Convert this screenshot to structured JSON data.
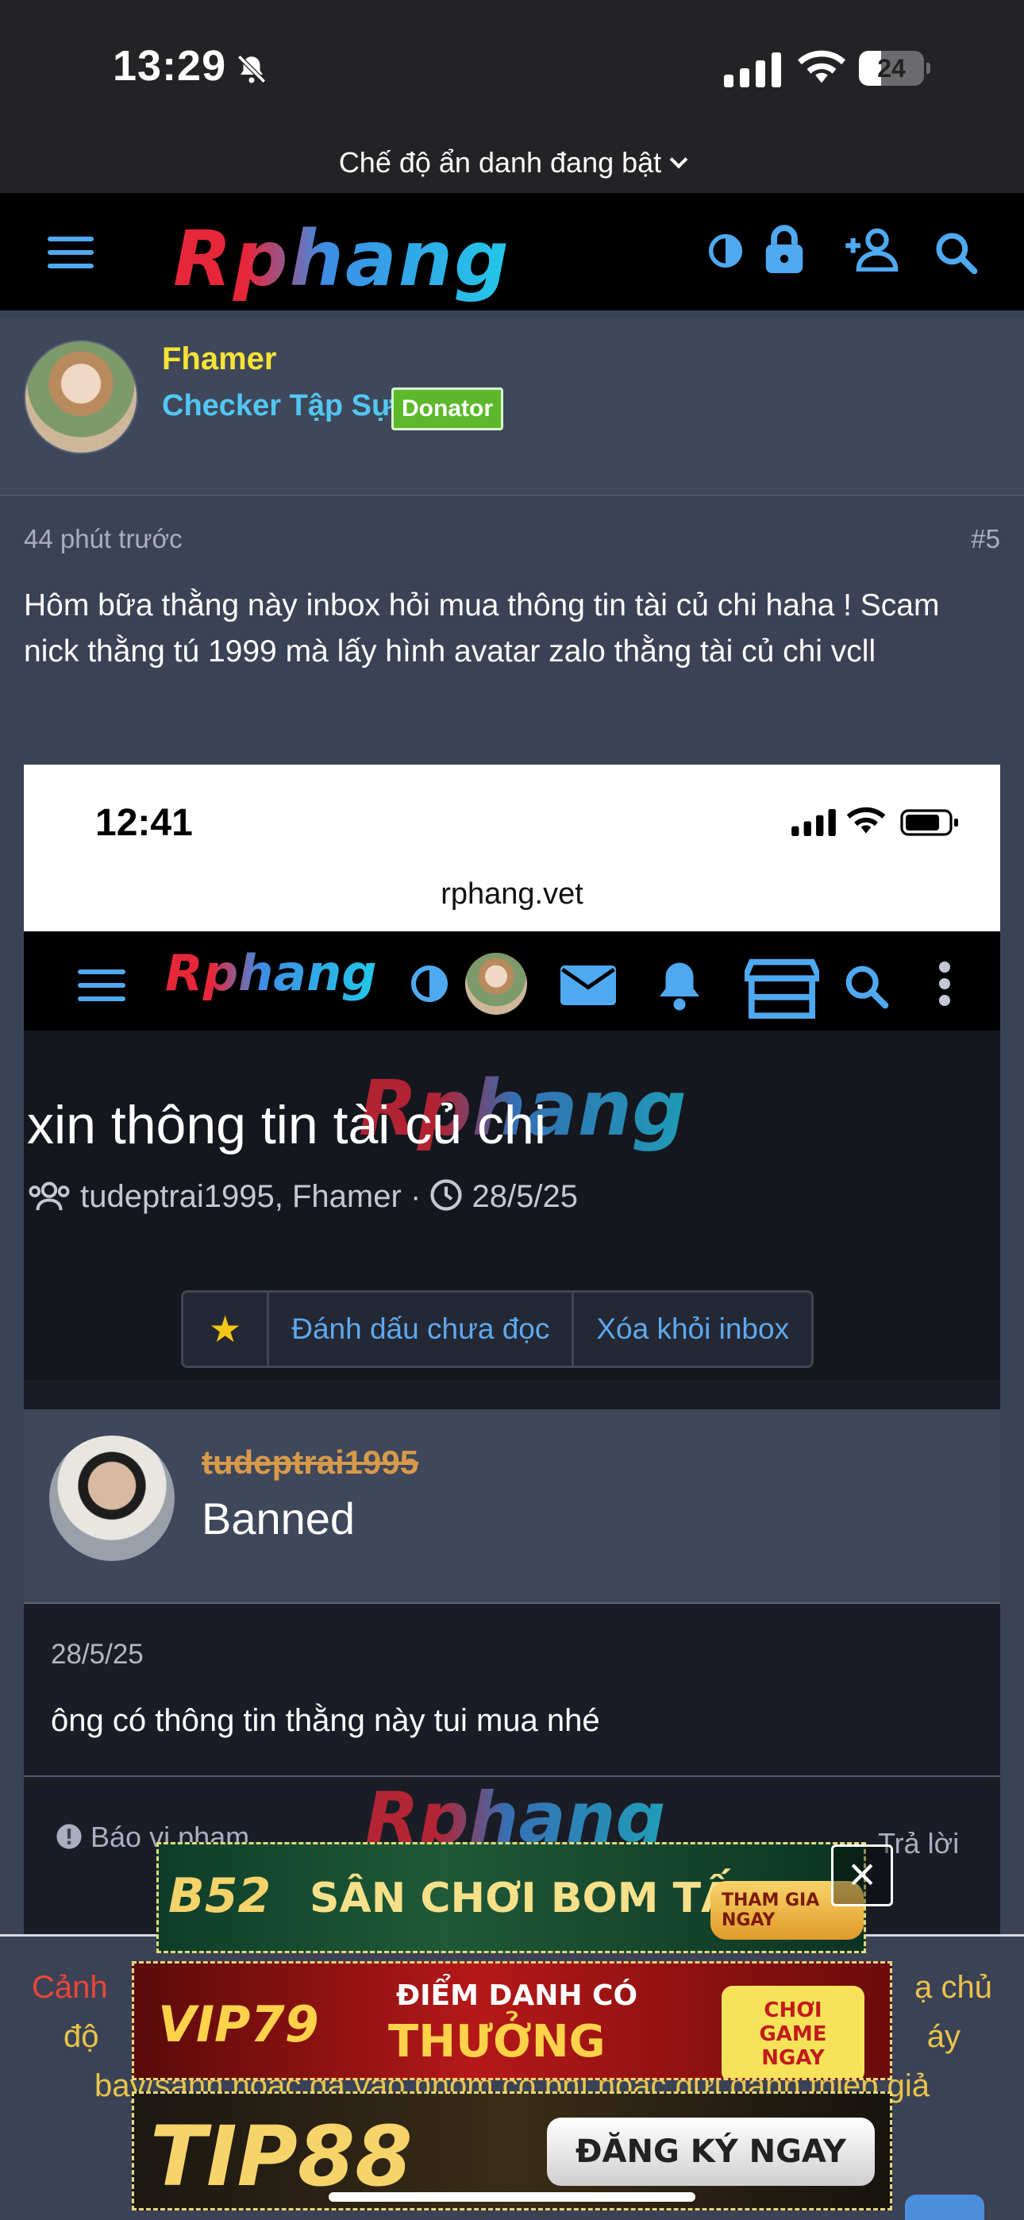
{
  "status_bar": {
    "time": "13:29",
    "battery": "24"
  },
  "browser": {
    "incognito_label": "Chế độ ẩn danh đang bật"
  },
  "nav": {
    "logo": "Rphang"
  },
  "member": {
    "name": "Fhamer",
    "title": "Checker Tập Sự",
    "badge": "Donator"
  },
  "post": {
    "time": "44 phút trước",
    "number": "#5",
    "body": "Hôm bữa thằng này inbox hỏi mua thông tin tài củ chi haha ! Scam nick thằng tú 1999 mà lấy hình avatar zalo thằng tài củ chi vcll"
  },
  "screenshot": {
    "time": "12:41",
    "url": "rphang.vet",
    "logo": "Rphang",
    "watermark": "Rphang",
    "thread_title": "xin thông tin tài củ chi",
    "participants": "tudeptrai1995, Fhamer",
    "date": "28/5/25",
    "buttons": {
      "star": "★",
      "mark_unread": "Đánh dấu chưa đọc",
      "remove_inbox": "Xóa khỏi inbox"
    },
    "sender_name": "tudeptrai1995",
    "sender_status": "Banned",
    "message_date": "28/5/25",
    "message": "ông có thông tin thằng này tui mua nhé",
    "report": "Báo vi phạm",
    "reply": "Trả lời"
  },
  "warning": {
    "prefix": "Cảnh",
    "line1_end": "ạ chủ",
    "line2_start": "độ",
    "line2_end": "áy",
    "line3": "bay/sảnh hoặc gạ vào nhóm có phí hoặc gửi danh thiếp giả"
  },
  "ads": {
    "b52_brand": "B52",
    "b52_text": "SÂN CHƠI BOM TẤN",
    "b52_cta": "THAM GIA NGAY",
    "vip79_brand": "VIP79",
    "vip79_text1": "ĐIỂM DANH CÓ",
    "vip79_text2": "THƯỞNG",
    "vip79_cta": "CHƠI GAME NGAY",
    "tip88_brand": "TIP88",
    "tip88_cta": "ĐĂNG KÝ NGAY",
    "close": "×"
  },
  "colors": {
    "accent": "#4fa9f0",
    "username": "#f7e334",
    "title": "#52c7f2",
    "donator": "#5db92b",
    "banned": "#d79a4b"
  }
}
